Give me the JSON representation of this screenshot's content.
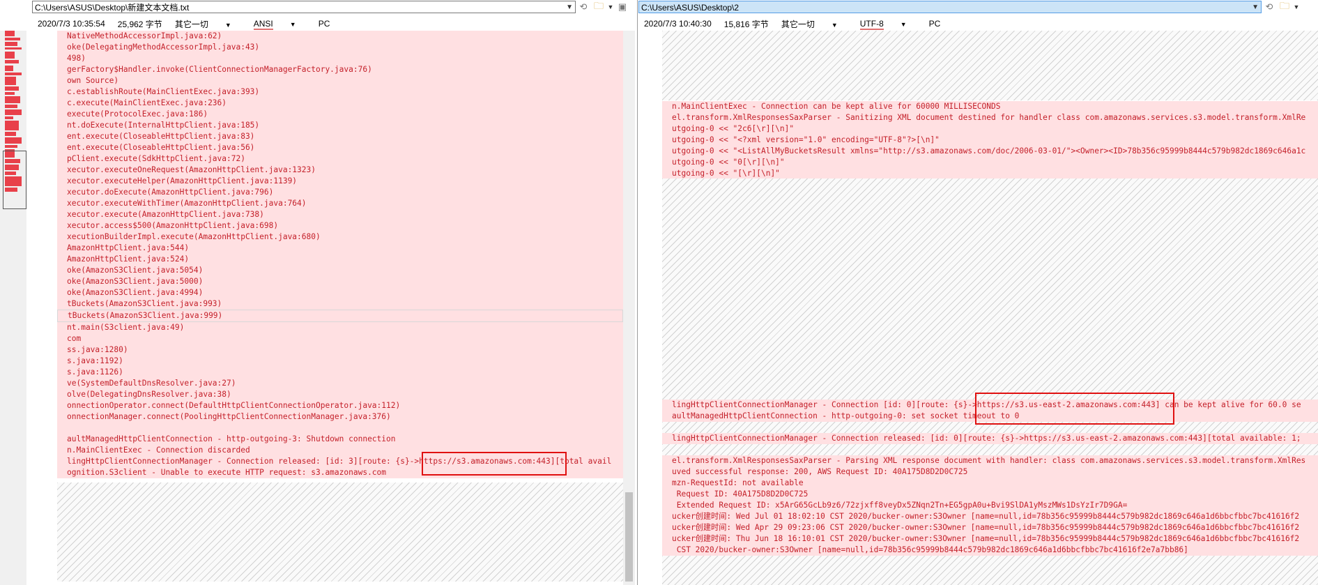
{
  "left": {
    "path": "C:\\Users\\ASUS\\Desktop\\新建文本文档.txt",
    "date": "2020/7/3 10:35:54",
    "size": "25,962 字节",
    "option": "其它一切",
    "encoding": "ANSI",
    "lineend": "PC",
    "lines_top": [
      "NativeMethodAccessorImpl.java:62)",
      "oke(DelegatingMethodAccessorImpl.java:43)",
      "498)",
      "gerFactory$Handler.invoke(ClientConnectionManagerFactory.java:76)",
      "own Source)",
      "c.establishRoute(MainClientExec.java:393)",
      "c.execute(MainClientExec.java:236)",
      "execute(ProtocolExec.java:186)",
      "nt.doExecute(InternalHttpClient.java:185)",
      "ent.execute(CloseableHttpClient.java:83)",
      "ent.execute(CloseableHttpClient.java:56)",
      "pClient.execute(SdkHttpClient.java:72)",
      "xecutor.executeOneRequest(AmazonHttpClient.java:1323)",
      "xecutor.executeHelper(AmazonHttpClient.java:1139)",
      "xecutor.doExecute(AmazonHttpClient.java:796)",
      "xecutor.executeWithTimer(AmazonHttpClient.java:764)",
      "xecutor.execute(AmazonHttpClient.java:738)",
      "xecutor.access$500(AmazonHttpClient.java:698)",
      "xecutionBuilderImpl.execute(AmazonHttpClient.java:680)",
      "AmazonHttpClient.java:544)",
      "AmazonHttpClient.java:524)",
      "oke(AmazonS3Client.java:5054)",
      "oke(AmazonS3Client.java:5000)",
      "oke(AmazonS3Client.java:4994)",
      "tBuckets(AmazonS3Client.java:993)",
      "tBuckets(AmazonS3Client.java:999)",
      "nt.main(S3client.java:49)",
      "com",
      "ss.java:1280)",
      "s.java:1192)",
      "s.java:1126)",
      "ve(SystemDefaultDnsResolver.java:27)",
      "olve(DelegatingDnsResolver.java:38)",
      "onnectionOperator.connect(DefaultHttpClientConnectionOperator.java:112)",
      "onnectionManager.connect(PoolingHttpClientConnectionManager.java:376)",
      "",
      "aultManagedHttpClientConnection - http-outgoing-3: Shutdown connection",
      "n.MainClientExec - Connection discarded",
      "lingHttpClientConnectionManager - Connection released: [id: 3][route: {s}->https://s3.amazonaws.com:443][total avail",
      "ognition.S3client - Unable to execute HTTP request: s3.amazonaws.com"
    ]
  },
  "right": {
    "path": "C:\\Users\\ASUS\\Desktop\\2",
    "date": "2020/7/3 10:40:30",
    "size": "15,816 字节",
    "option": "其它一切",
    "encoding": "UTF-8",
    "lineend": "PC",
    "block1": [
      "n.MainClientExec - Connection can be kept alive for 60000 MILLISECONDS",
      "el.transform.XmlResponsesSaxParser - Sanitizing XML document destined for handler class com.amazonaws.services.s3.model.transform.XmlRe",
      "utgoing-0 << \"2c6[\\r][\\n]\"",
      "utgoing-0 << \"<?xml version=\"1.0\" encoding=\"UTF-8\"?>[\\n]\"",
      "utgoing-0 << \"<ListAllMyBucketsResult xmlns=\"http://s3.amazonaws.com/doc/2006-03-01/\"><Owner><ID>78b356c95999b8444c579b982dc1869c646a1c",
      "utgoing-0 << \"0[\\r][\\n]\"",
      "utgoing-0 << \"[\\r][\\n]\""
    ],
    "block2": [
      "lingHttpClientConnectionManager - Connection [id: 0][route: {s}->https://s3.us-east-2.amazonaws.com:443] can be kept alive for 60.0 se",
      "aultManagedHttpClientConnection - http-outgoing-0: set socket timeout to 0"
    ],
    "block3": [
      "lingHttpClientConnectionManager - Connection released: [id: 0][route: {s}->https://s3.us-east-2.amazonaws.com:443][total available: 1;"
    ],
    "block4": [
      "el.transform.XmlResponsesSaxParser - Parsing XML response document with handler: class com.amazonaws.services.s3.model.transform.XmlRes",
      "uved successful response: 200, AWS Request ID: 40A175D8D2D0C725",
      "mzn-RequestId: not available",
      " Request ID: 40A175D8D2D0C725",
      " Extended Request ID: x5ArG65GcLb9z6/72zjxff8veyDx5ZNqn2Tn+EG5gpA0u+Bvi9SlDA1yMszMWs1DsYzIr7D9GA=",
      "ucker创建时间: Wed Jul 01 18:02:10 CST 2020/bucker-owner:S3Owner [name=null,id=78b356c95999b8444c579b982dc1869c646a1d6bbcfbbc7bc41616f2",
      "ucker创建时间: Wed Apr 29 09:23:06 CST 2020/bucker-owner:S3Owner [name=null,id=78b356c95999b8444c579b982dc1869c646a1d6bbcfbbc7bc41616f2",
      "ucker创建时间: Thu Jun 18 16:10:01 CST 2020/bucker-owner:S3Owner [name=null,id=78b356c95999b8444c579b982dc1869c646a1d6bbcfbbc7bc41616f2",
      " CST 2020/bucker-owner:S3Owner [name=null,id=78b356c95999b8444c579b982dc1869c646a1d6bbcfbbc7bc41616f2e7a7bb86]"
    ]
  },
  "icons": {
    "refresh": "refresh-icon",
    "folder": "folder-icon",
    "save": "save-icon"
  },
  "colors": {
    "diff_text": "#c4202a",
    "diff_bg": "#ffe0e2",
    "highlight_box": "#e01010"
  }
}
